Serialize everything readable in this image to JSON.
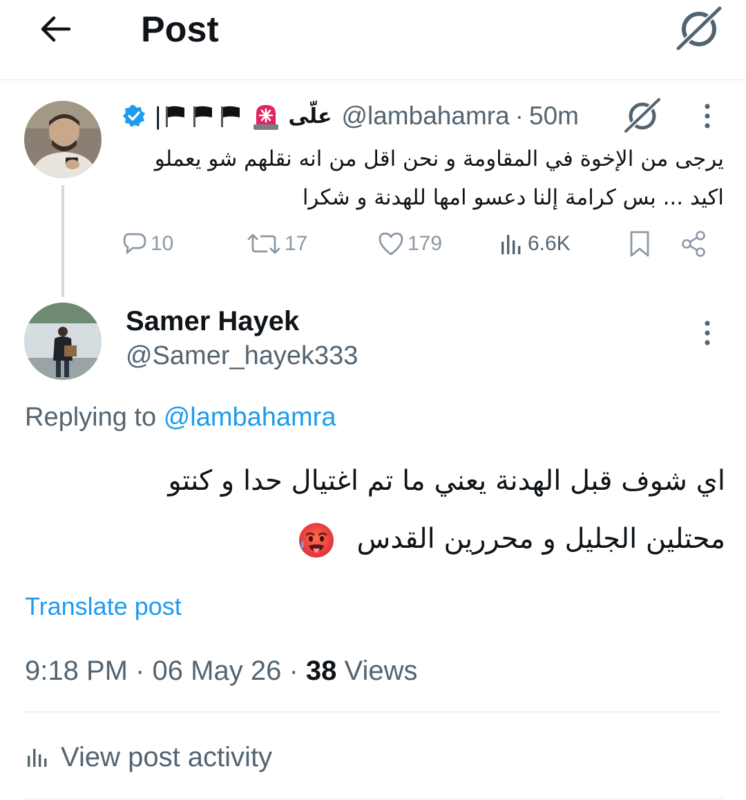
{
  "header": {
    "title": "Post"
  },
  "original_post": {
    "display_name": "علّى",
    "handle": "@lambahamra",
    "separator": "·",
    "time": "50m",
    "name_decorations": [
      "verified-badge-icon",
      "pipe",
      "black-flag",
      "black-flag",
      "black-flag",
      "siren-icon"
    ],
    "text": "يرجى من الإخوة في المقاومة و نحن اقل من انه نقلهم شو يعملو اكيد ... بس كرامة إلنا دعسو امها للهدنة و شكرا",
    "stats": {
      "replies": "10",
      "reposts": "17",
      "likes": "179",
      "views": "6.6K"
    }
  },
  "reply": {
    "display_name": "Samer Hayek",
    "handle": "@Samer_hayek333",
    "replying_prefix": "Replying to",
    "replying_to": "@lambahamra",
    "text": "اي شوف قبل الهدنة يعني ما تم اغتيال حدا و كنتو محتلين الجليل و محررين القدس",
    "emoji": "hot-face-emoji",
    "translate_label": "Translate post",
    "time": "9:18 PM",
    "date": "06 May 26",
    "meta_sep": "·",
    "views_count": "38",
    "views_label": "Views"
  },
  "activity": {
    "label": "View post activity"
  },
  "colors": {
    "link": "#1d9bf0",
    "secondary_text": "#536471",
    "primary_text": "#0f1419",
    "divider": "#e1e6ea"
  }
}
